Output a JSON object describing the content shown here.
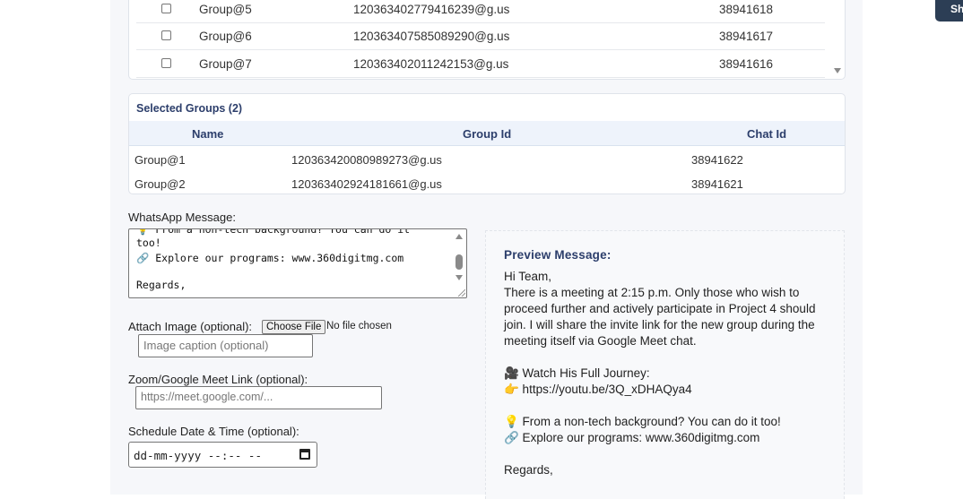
{
  "groups_table": {
    "rows": [
      {
        "name": "Group@5",
        "group_id": "120363402779416239@g.us",
        "chat_id": "38941618"
      },
      {
        "name": "Group@6",
        "group_id": "120363407585089290@g.us",
        "chat_id": "38941617"
      },
      {
        "name": "Group@7",
        "group_id": "120363402011242153@g.us",
        "chat_id": "38941616"
      }
    ]
  },
  "selected_groups": {
    "title": "Selected Groups (2)",
    "headers": {
      "name": "Name",
      "group_id": "Group Id",
      "chat_id": "Chat Id"
    },
    "rows": [
      {
        "name": "Group@1",
        "group_id": "120363420080989273@g.us",
        "chat_id": "38941622"
      },
      {
        "name": "Group@2",
        "group_id": "120363402924181661@g.us",
        "chat_id": "38941621"
      }
    ]
  },
  "message": {
    "label": "WhatsApp Message:",
    "visible_lines": [
      "💡 From a non-tech background? You can do it",
      "too!",
      "🔗 Explore our programs: www.360digitmg.com",
      "",
      "Regards,"
    ]
  },
  "attach": {
    "label": "Attach Image (optional):",
    "button": "Choose File",
    "status": "No file chosen",
    "caption_placeholder": "Image caption (optional)"
  },
  "meet": {
    "label": "Zoom/Google Meet Link (optional):",
    "placeholder": "https://meet.google.com/..."
  },
  "schedule": {
    "label": "Schedule Date & Time (optional):",
    "value": "dd-mm-yyyy --:-- --"
  },
  "preview": {
    "title": "Preview Message:",
    "lines": [
      "Hi Team,",
      "There is a meeting at 2:15 p.m. Only those who wish to",
      "proceed further and actively participate in Project 4 should",
      "join. I will share the invite link for the new group during the",
      "meeting itself via Google Meet chat.",
      "",
      "🎥 Watch His Full Journey:",
      "👉 https://youtu.be/3Q_xDHAQya4",
      "",
      "💡 From a non-tech background? You can do it too!",
      "🔗 Explore our programs: www.360digitmg.com",
      "",
      "Regards,"
    ]
  },
  "top_button": {
    "label": "Sh"
  }
}
